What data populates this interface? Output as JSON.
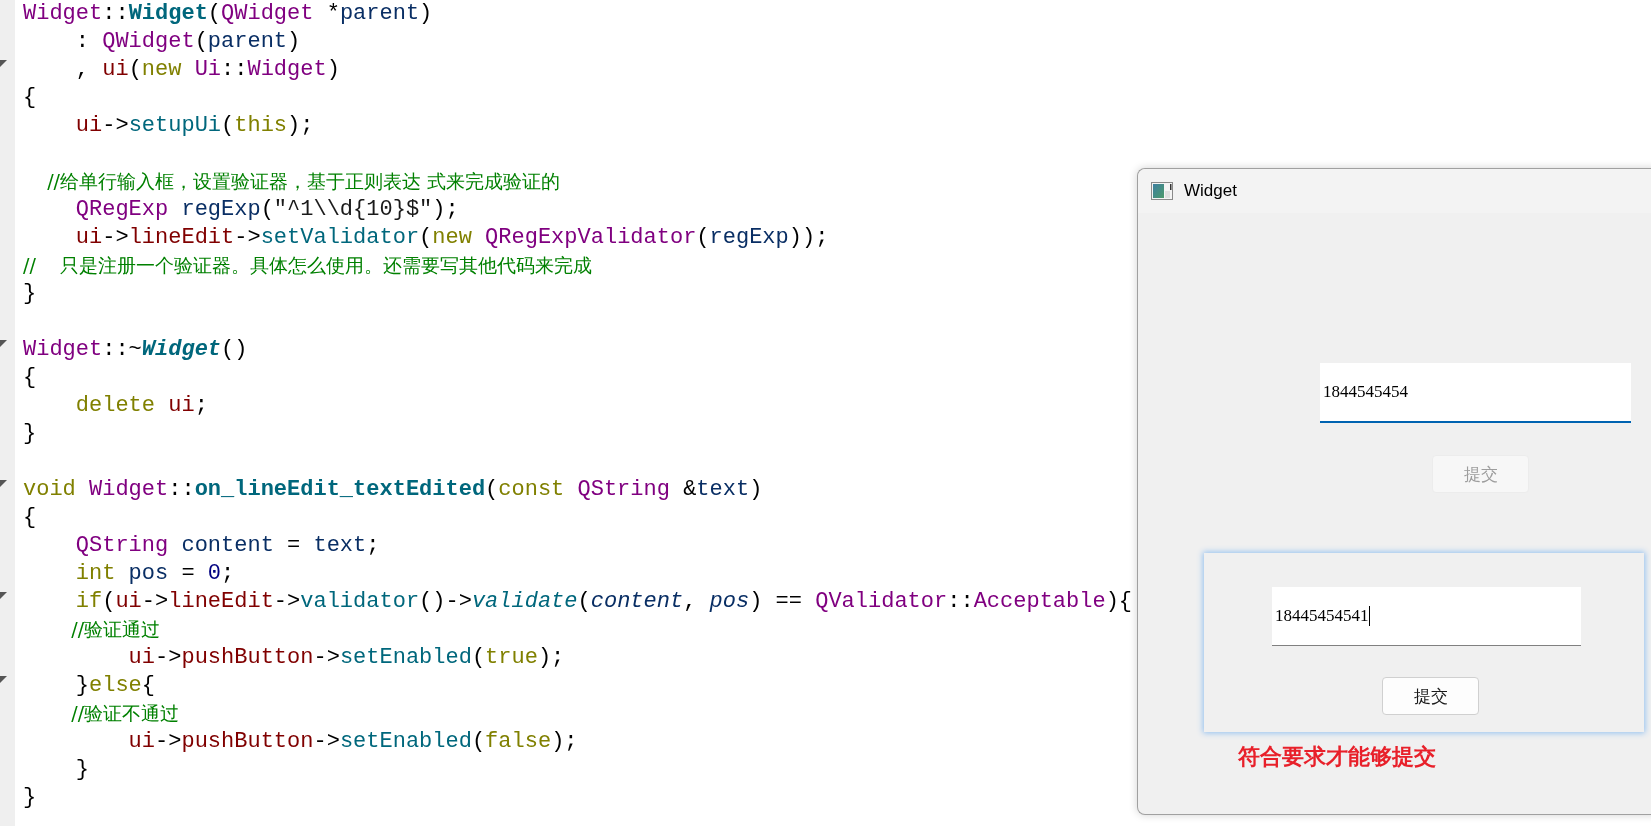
{
  "editor": {
    "lines": [
      {
        "fold": false,
        "tokens": [
          {
            "kind": "type",
            "text": "Widget"
          },
          {
            "kind": "punct",
            "text": "::"
          },
          {
            "kind": "func_bold",
            "text": "Widget"
          },
          {
            "kind": "punct",
            "text": "("
          },
          {
            "kind": "type",
            "text": "QWidget"
          },
          {
            "kind": "punct",
            "text": " *"
          },
          {
            "kind": "local",
            "text": "parent"
          },
          {
            "kind": "punct",
            "text": ")"
          }
        ]
      },
      {
        "fold": false,
        "tokens": [
          {
            "kind": "punct",
            "text": "    : "
          },
          {
            "kind": "type",
            "text": "QWidget"
          },
          {
            "kind": "punct",
            "text": "("
          },
          {
            "kind": "local",
            "text": "parent"
          },
          {
            "kind": "punct",
            "text": ")"
          }
        ]
      },
      {
        "fold": true,
        "tokens": [
          {
            "kind": "punct",
            "text": "    , "
          },
          {
            "kind": "member",
            "text": "ui"
          },
          {
            "kind": "punct",
            "text": "("
          },
          {
            "kind": "keyword",
            "text": "new"
          },
          {
            "kind": "type",
            "text": " Ui"
          },
          {
            "kind": "punct",
            "text": "::"
          },
          {
            "kind": "type",
            "text": "Widget"
          },
          {
            "kind": "punct",
            "text": ")"
          }
        ]
      },
      {
        "fold": false,
        "tokens": [
          {
            "kind": "punct",
            "text": "{"
          }
        ]
      },
      {
        "fold": false,
        "tokens": [
          {
            "kind": "member",
            "text": "    ui"
          },
          {
            "kind": "punct",
            "text": "->"
          },
          {
            "kind": "func",
            "text": "setupUi"
          },
          {
            "kind": "punct",
            "text": "("
          },
          {
            "kind": "keyword",
            "text": "this"
          },
          {
            "kind": "punct",
            "text": ");"
          }
        ]
      },
      {
        "fold": false
      },
      {
        "fold": false,
        "tokens": [
          {
            "kind": "comment",
            "text": "    //给单行输入框，设置验证器，基于正则表达 式来完成验证的"
          }
        ]
      },
      {
        "fold": false,
        "tokens": [
          {
            "kind": "type",
            "text": "    QRegExp"
          },
          {
            "kind": "local",
            "text": " regExp"
          },
          {
            "kind": "punct",
            "text": "("
          },
          {
            "kind": "string",
            "text": "\"^1\\\\d{10}$\""
          },
          {
            "kind": "punct",
            "text": ");"
          }
        ]
      },
      {
        "fold": false,
        "tokens": [
          {
            "kind": "member",
            "text": "    ui"
          },
          {
            "kind": "punct",
            "text": "->"
          },
          {
            "kind": "member",
            "text": "lineEdit"
          },
          {
            "kind": "punct",
            "text": "->"
          },
          {
            "kind": "func",
            "text": "setValidator"
          },
          {
            "kind": "punct",
            "text": "("
          },
          {
            "kind": "keyword",
            "text": "new"
          },
          {
            "kind": "type",
            "text": " QRegExpValidator"
          },
          {
            "kind": "punct",
            "text": "("
          },
          {
            "kind": "local",
            "text": "regExp"
          },
          {
            "kind": "punct",
            "text": "));"
          }
        ]
      },
      {
        "fold": false,
        "tokens": [
          {
            "kind": "comment",
            "text": "//    只是注册一个验证器。具体怎么使用。还需要写其他代码来完成"
          }
        ]
      },
      {
        "fold": false,
        "tokens": [
          {
            "kind": "punct",
            "text": "}"
          }
        ]
      },
      {
        "fold": false
      },
      {
        "fold": true,
        "tokens": [
          {
            "kind": "type",
            "text": "Widget"
          },
          {
            "kind": "punct",
            "text": "::~"
          },
          {
            "kind": "func_bold_italic",
            "text": "Widget"
          },
          {
            "kind": "punct",
            "text": "()"
          }
        ]
      },
      {
        "fold": false,
        "tokens": [
          {
            "kind": "punct",
            "text": "{"
          }
        ]
      },
      {
        "fold": false,
        "tokens": [
          {
            "kind": "keyword",
            "text": "    delete"
          },
          {
            "kind": "member",
            "text": " ui"
          },
          {
            "kind": "punct",
            "text": ";"
          }
        ]
      },
      {
        "fold": false,
        "tokens": [
          {
            "kind": "punct",
            "text": "}"
          }
        ]
      },
      {
        "fold": false
      },
      {
        "fold": true,
        "tokens": [
          {
            "kind": "keyword",
            "text": "void"
          },
          {
            "kind": "type",
            "text": " Widget"
          },
          {
            "kind": "punct",
            "text": "::"
          },
          {
            "kind": "func_bold",
            "text": "on_lineEdit_textEdited"
          },
          {
            "kind": "punct",
            "text": "("
          },
          {
            "kind": "keyword",
            "text": "const"
          },
          {
            "kind": "type",
            "text": " QString"
          },
          {
            "kind": "punct",
            "text": " &"
          },
          {
            "kind": "local",
            "text": "text"
          },
          {
            "kind": "punct",
            "text": ")"
          }
        ]
      },
      {
        "fold": false,
        "tokens": [
          {
            "kind": "punct",
            "text": "{"
          }
        ]
      },
      {
        "fold": false,
        "tokens": [
          {
            "kind": "type",
            "text": "    QString"
          },
          {
            "kind": "local",
            "text": " content"
          },
          {
            "kind": "punct",
            "text": " = "
          },
          {
            "kind": "local",
            "text": "text"
          },
          {
            "kind": "punct",
            "text": ";"
          }
        ]
      },
      {
        "fold": false,
        "tokens": [
          {
            "kind": "keyword",
            "text": "    int"
          },
          {
            "kind": "local",
            "text": " pos"
          },
          {
            "kind": "punct",
            "text": " = "
          },
          {
            "kind": "number",
            "text": "0"
          },
          {
            "kind": "punct",
            "text": ";"
          }
        ]
      },
      {
        "fold": true,
        "tokens": [
          {
            "kind": "keyword",
            "text": "    if"
          },
          {
            "kind": "punct",
            "text": "("
          },
          {
            "kind": "member",
            "text": "ui"
          },
          {
            "kind": "punct",
            "text": "->"
          },
          {
            "kind": "member",
            "text": "lineEdit"
          },
          {
            "kind": "punct",
            "text": "->"
          },
          {
            "kind": "func",
            "text": "validator"
          },
          {
            "kind": "punct",
            "text": "()->"
          },
          {
            "kind": "func_italic",
            "text": "validate"
          },
          {
            "kind": "punct",
            "text": "("
          },
          {
            "kind": "param",
            "text": "content"
          },
          {
            "kind": "punct",
            "text": ", "
          },
          {
            "kind": "param",
            "text": "pos"
          },
          {
            "kind": "punct",
            "text": ") == "
          },
          {
            "kind": "type",
            "text": "QValidator"
          },
          {
            "kind": "punct",
            "text": "::"
          },
          {
            "kind": "type",
            "text": "Acceptable"
          },
          {
            "kind": "punct",
            "text": "){"
          }
        ]
      },
      {
        "fold": false,
        "tokens": [
          {
            "kind": "comment",
            "text": "        //验证通过"
          }
        ]
      },
      {
        "fold": false,
        "tokens": [
          {
            "kind": "member",
            "text": "        ui"
          },
          {
            "kind": "punct",
            "text": "->"
          },
          {
            "kind": "member",
            "text": "pushButton"
          },
          {
            "kind": "punct",
            "text": "->"
          },
          {
            "kind": "func",
            "text": "setEnabled"
          },
          {
            "kind": "punct",
            "text": "("
          },
          {
            "kind": "keyword",
            "text": "true"
          },
          {
            "kind": "punct",
            "text": ");"
          }
        ]
      },
      {
        "fold": true,
        "tokens": [
          {
            "kind": "punct",
            "text": "    }"
          },
          {
            "kind": "keyword",
            "text": "else"
          },
          {
            "kind": "punct",
            "text": "{"
          }
        ]
      },
      {
        "fold": false,
        "tokens": [
          {
            "kind": "comment",
            "text": "        //验证不通过"
          }
        ]
      },
      {
        "fold": false,
        "tokens": [
          {
            "kind": "member",
            "text": "        ui"
          },
          {
            "kind": "punct",
            "text": "->"
          },
          {
            "kind": "member",
            "text": "pushButton"
          },
          {
            "kind": "punct",
            "text": "->"
          },
          {
            "kind": "func",
            "text": "setEnabled"
          },
          {
            "kind": "punct",
            "text": "("
          },
          {
            "kind": "keyword",
            "text": "false"
          },
          {
            "kind": "punct",
            "text": ");"
          }
        ]
      },
      {
        "fold": false,
        "tokens": [
          {
            "kind": "punct",
            "text": "    }"
          }
        ]
      },
      {
        "fold": false,
        "tokens": [
          {
            "kind": "punct",
            "text": "}"
          }
        ]
      }
    ]
  },
  "window": {
    "title": "Widget",
    "line_edit": {
      "value": "1844545454",
      "focused": true,
      "caret": false
    },
    "submit_button": {
      "label": "提交",
      "disabled": true
    },
    "inset_screenshot": {
      "line_edit": {
        "value": "18445454541",
        "focused": false,
        "caret": true
      },
      "submit_button": {
        "label": "提交",
        "disabled": false
      }
    },
    "annotation": "符合要求才能够提交"
  }
}
